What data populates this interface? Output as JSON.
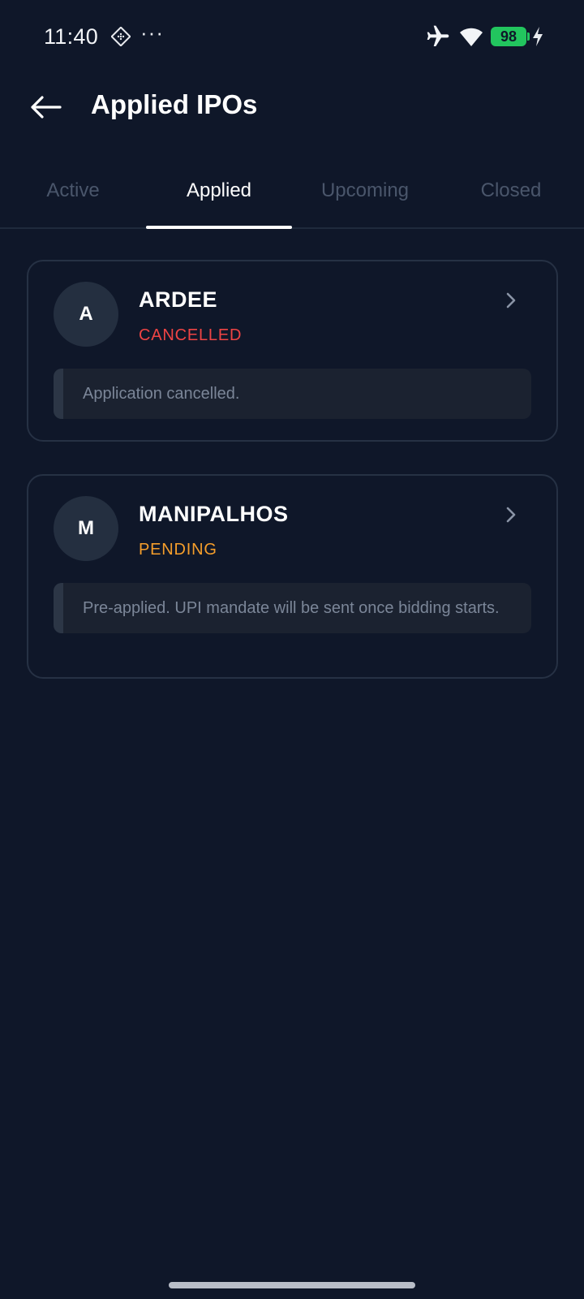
{
  "status_bar": {
    "time": "11:40",
    "dots": "···",
    "battery_level": "98",
    "battery_color": "#22c55e"
  },
  "header": {
    "title": "Applied IPOs"
  },
  "tabs": [
    {
      "label": "Active",
      "active": false
    },
    {
      "label": "Applied",
      "active": true
    },
    {
      "label": "Upcoming",
      "active": false
    },
    {
      "label": "Closed",
      "active": false
    }
  ],
  "cards": [
    {
      "initial": "A",
      "name": "ARDEE",
      "status": "CANCELLED",
      "status_color": "#ef4444",
      "note": "Application cancelled."
    },
    {
      "initial": "M",
      "name": "MANIPALHOS",
      "status": "PENDING",
      "status_color": "#f59e2b",
      "note": "Pre-applied. UPI mandate will be sent once bidding starts."
    }
  ],
  "colors": {
    "background": "#0f1729",
    "card_border": "#263144",
    "inactive_tab": "#4a566b"
  }
}
